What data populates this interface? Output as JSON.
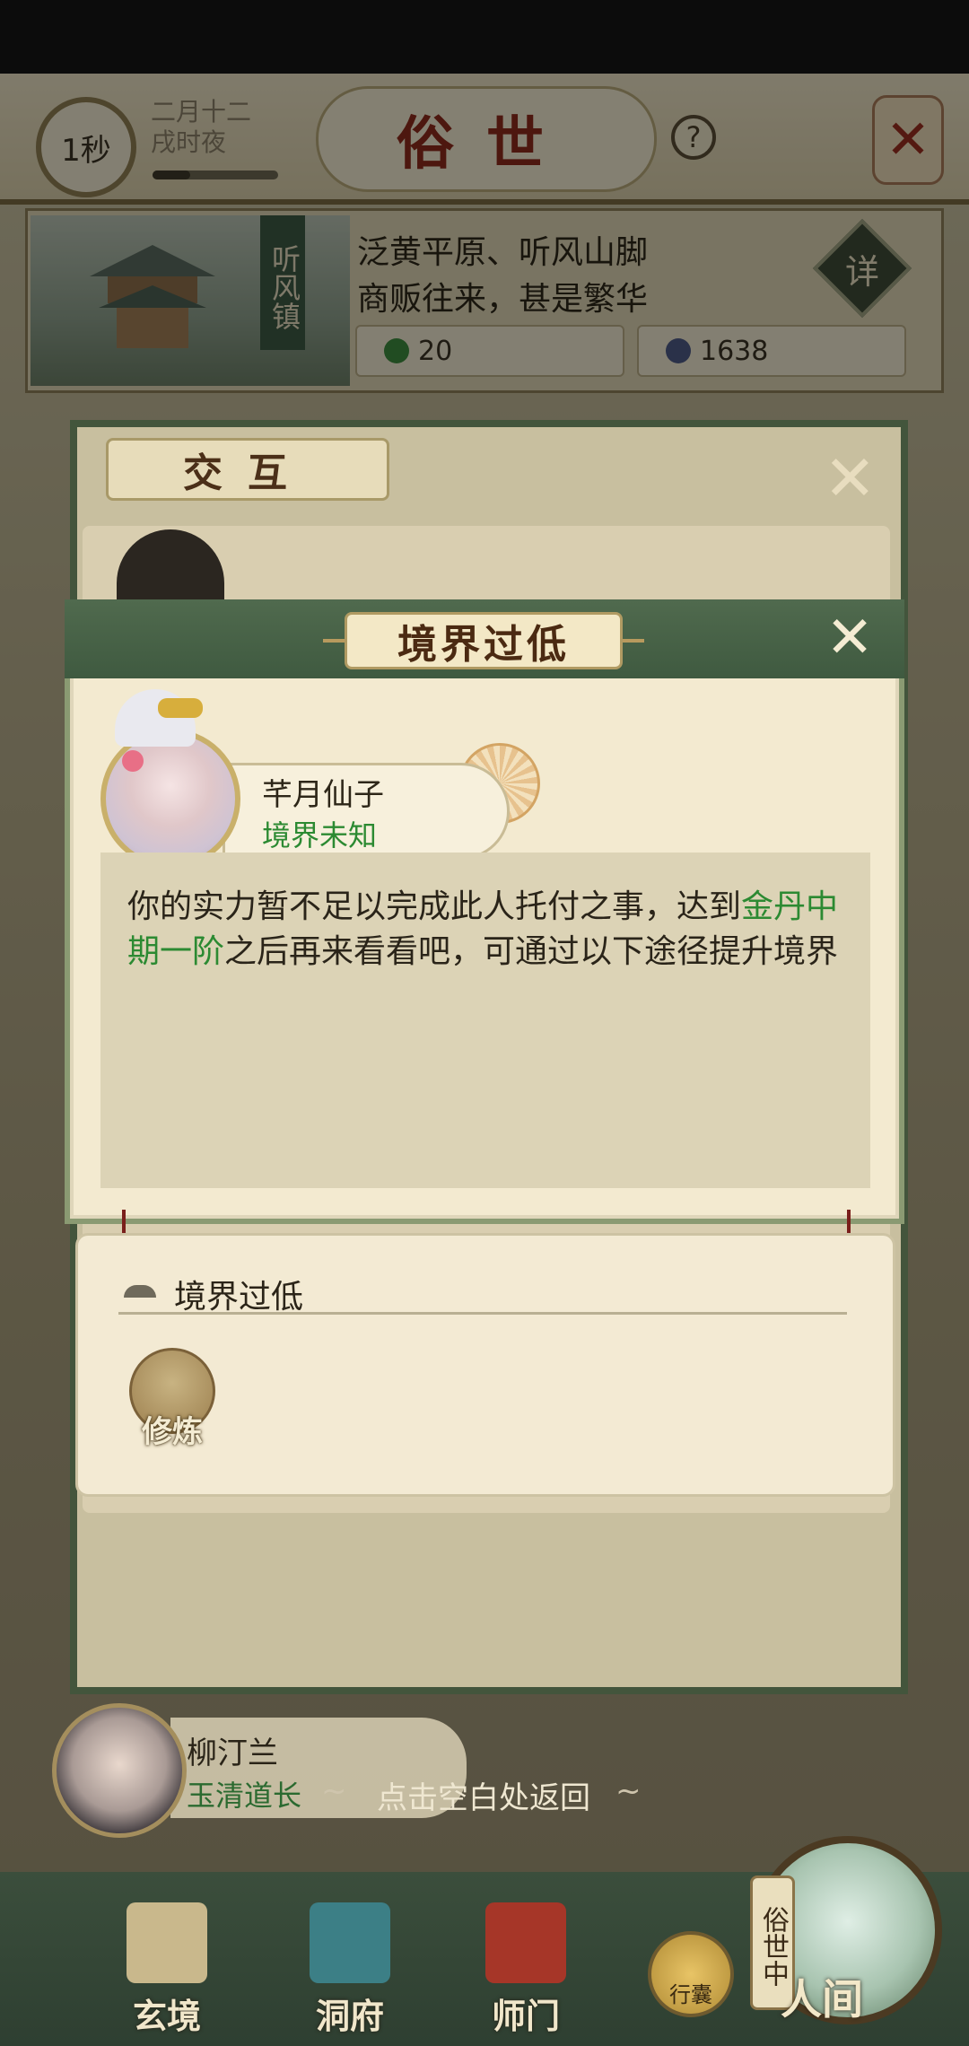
{
  "hud": {
    "timer": "1秒",
    "date_line1": "二月十二",
    "date_line2": "戌时夜",
    "scene_title": "俗世",
    "help_icon": "?",
    "close_icon": "✕"
  },
  "location": {
    "town_name": "听风镇",
    "line1": "泛黄平原、听风山脚",
    "line2": "商贩往来，甚是繁华",
    "detail_label": "详",
    "resource_jade": "20",
    "resource_coin": "1638"
  },
  "bg_dialog": {
    "title": "交互",
    "close_icon": "✕"
  },
  "modal": {
    "title": "境界过低",
    "close_icon": "✕",
    "npc_name": "芊月仙子",
    "npc_realm": "境界未知",
    "text_part1": "你的实力暂不足以完成此人托付之事，达到",
    "text_highlight": "金丹中期一阶",
    "text_part2": "之后再来看看吧，可通过以下途径提升境界"
  },
  "routes": {
    "header": "境界过低",
    "cultivate_label": "修炼"
  },
  "bottom_npc": {
    "name": "柳汀兰",
    "sect": "玉清道长",
    "return_hint": "点击空白处返回"
  },
  "nav": {
    "items": [
      {
        "label": "玄境",
        "icon": "scroll-icon"
      },
      {
        "label": "洞府",
        "icon": "pagoda-icon"
      },
      {
        "label": "师门",
        "icon": "banner-icon"
      }
    ],
    "bag_label": "行囊",
    "world_tag": "俗世中",
    "world_label": "人间"
  },
  "colors": {
    "accent_green": "#2c8a32",
    "title_red": "#8c2a1c",
    "header_green": "#506a4e"
  }
}
